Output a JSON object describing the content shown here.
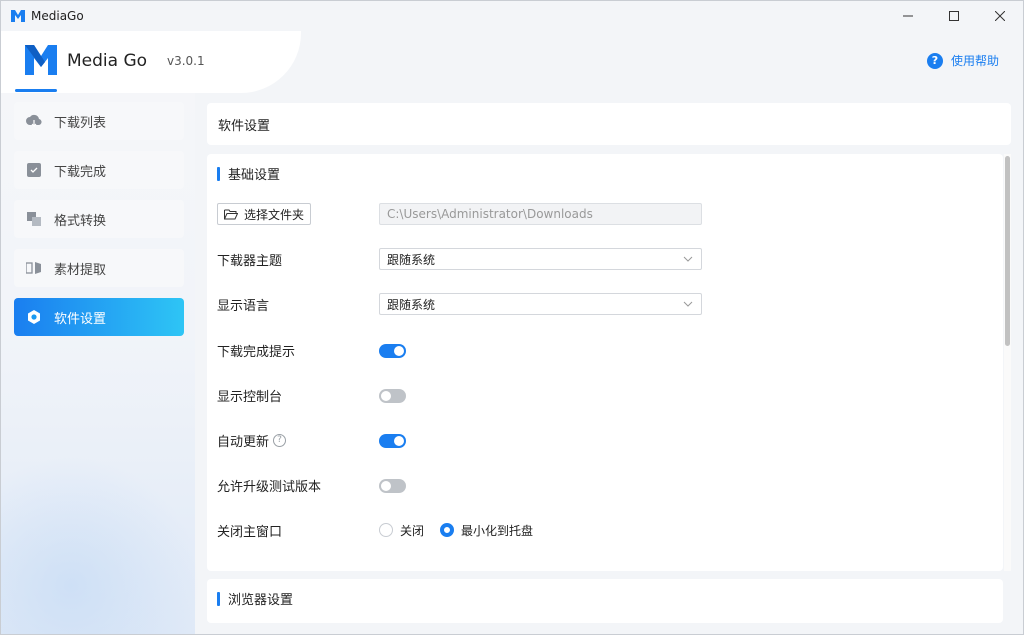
{
  "window": {
    "title": "MediaGo",
    "controls": [
      "minimize-icon",
      "maximize-icon",
      "close-icon"
    ]
  },
  "brand": {
    "name": "Media Go",
    "version": "v3.0.1"
  },
  "help": {
    "label": "使用帮助",
    "icon": "question-circle-icon"
  },
  "colors": {
    "accent": "#1a7ef0",
    "accent_gradient_end": "#2ec5f5",
    "toggle_off": "#bfc3c8"
  },
  "sidebar": {
    "items": [
      {
        "label": "下载列表",
        "icon": "cloud-download-icon",
        "active": false
      },
      {
        "label": "下载完成",
        "icon": "inbox-check-icon",
        "active": false
      },
      {
        "label": "格式转换",
        "icon": "convert-icon",
        "active": false
      },
      {
        "label": "素材提取",
        "icon": "extract-icon",
        "active": false
      },
      {
        "label": "软件设置",
        "icon": "settings-icon",
        "active": true
      }
    ]
  },
  "main": {
    "header": "软件设置",
    "basic_section": {
      "title": "基础设置",
      "folder_button": "选择文件夹",
      "folder_path": "C:\\Users\\Administrator\\Downloads",
      "theme_label": "下载器主题",
      "theme_value": "跟随系统",
      "language_label": "显示语言",
      "language_value": "跟随系统",
      "download_notify_label": "下载完成提示",
      "download_notify_on": true,
      "show_console_label": "显示控制台",
      "show_console_on": false,
      "auto_update_label": "自动更新",
      "auto_update_on": true,
      "beta_label": "允许升级测试版本",
      "beta_on": false,
      "close_window_label": "关闭主窗口",
      "close_options": [
        {
          "label": "关闭",
          "checked": false
        },
        {
          "label": "最小化到托盘",
          "checked": true
        }
      ]
    },
    "browser_section": {
      "title": "浏览器设置"
    }
  }
}
